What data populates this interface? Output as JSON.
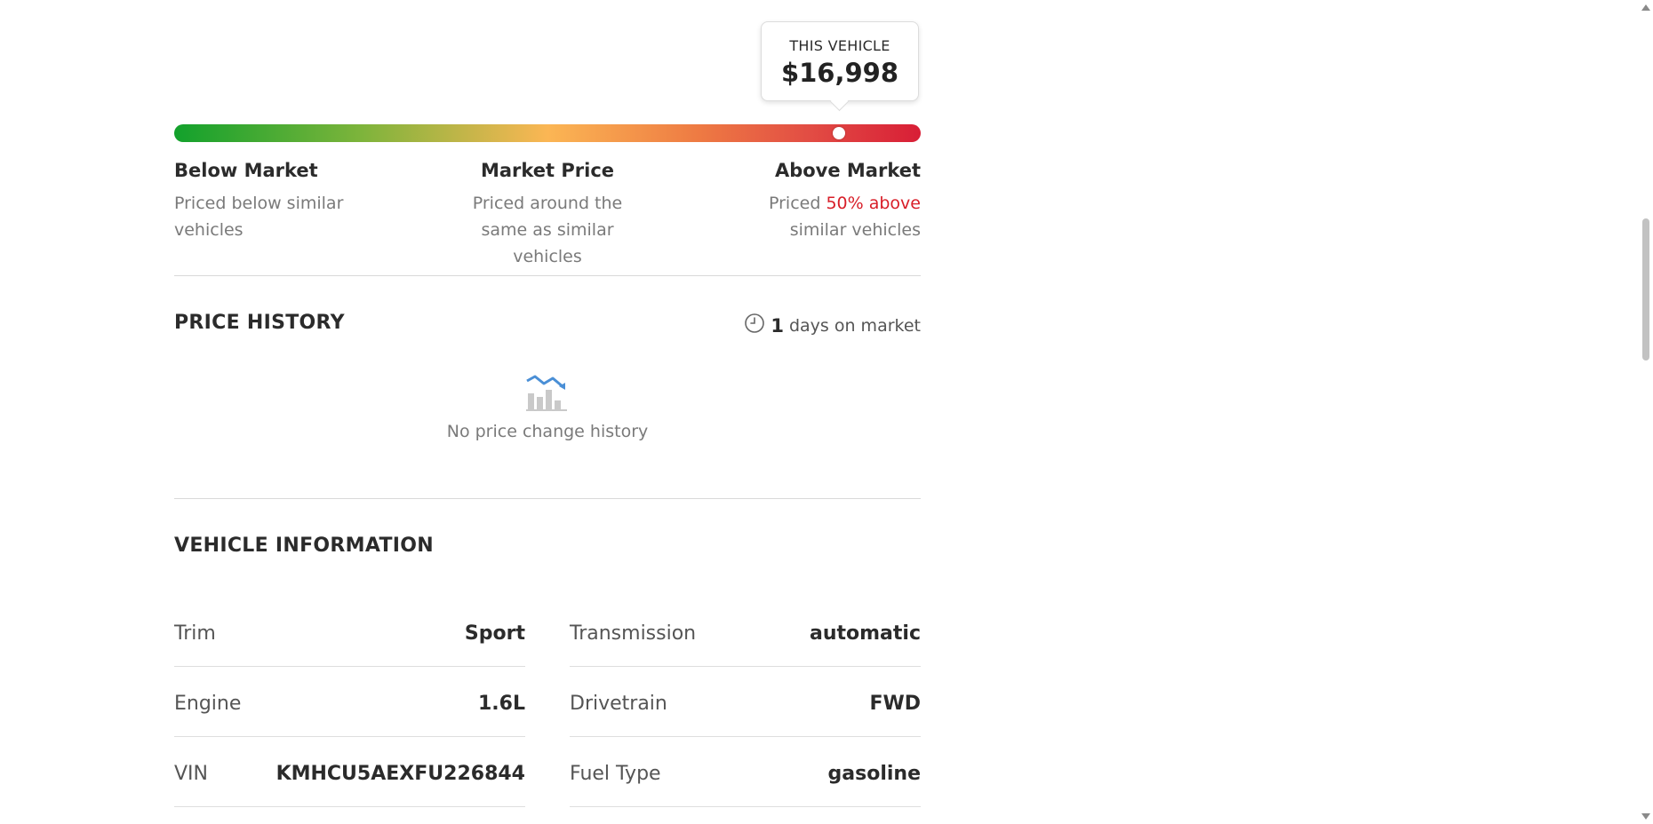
{
  "gauge": {
    "tooltip_label": "THIS VEHICLE",
    "tooltip_price": "$16,998",
    "position_fraction": 0.89,
    "below": {
      "title": "Below Market",
      "desc": "Priced below similar vehicles"
    },
    "market": {
      "title": "Market Price",
      "desc": "Priced around the same as similar vehicles"
    },
    "above": {
      "title": "Above Market",
      "desc_prefix": "Priced",
      "highlight": "50% above",
      "desc_suffix": "similar vehicles"
    },
    "colors": {
      "green": "#12a12c",
      "yellow": "#fbb654",
      "red": "#d81e36",
      "highlight": "#d81e28"
    }
  },
  "price_history": {
    "title": "PRICE HISTORY",
    "days_value": "1",
    "days_label": "days on market",
    "empty_icon": "chart-down-icon",
    "empty_message": "No price change history"
  },
  "vehicle_info": {
    "title": "VEHICLE INFORMATION",
    "left": [
      {
        "label": "Trim",
        "value": "Sport"
      },
      {
        "label": "Engine",
        "value": "1.6L"
      },
      {
        "label": "VIN",
        "value": "KMHCU5AEXFU226844"
      }
    ],
    "right": [
      {
        "label": "Transmission",
        "value": "automatic"
      },
      {
        "label": "Drivetrain",
        "value": "FWD"
      },
      {
        "label": "Fuel Type",
        "value": "gasoline"
      }
    ]
  }
}
